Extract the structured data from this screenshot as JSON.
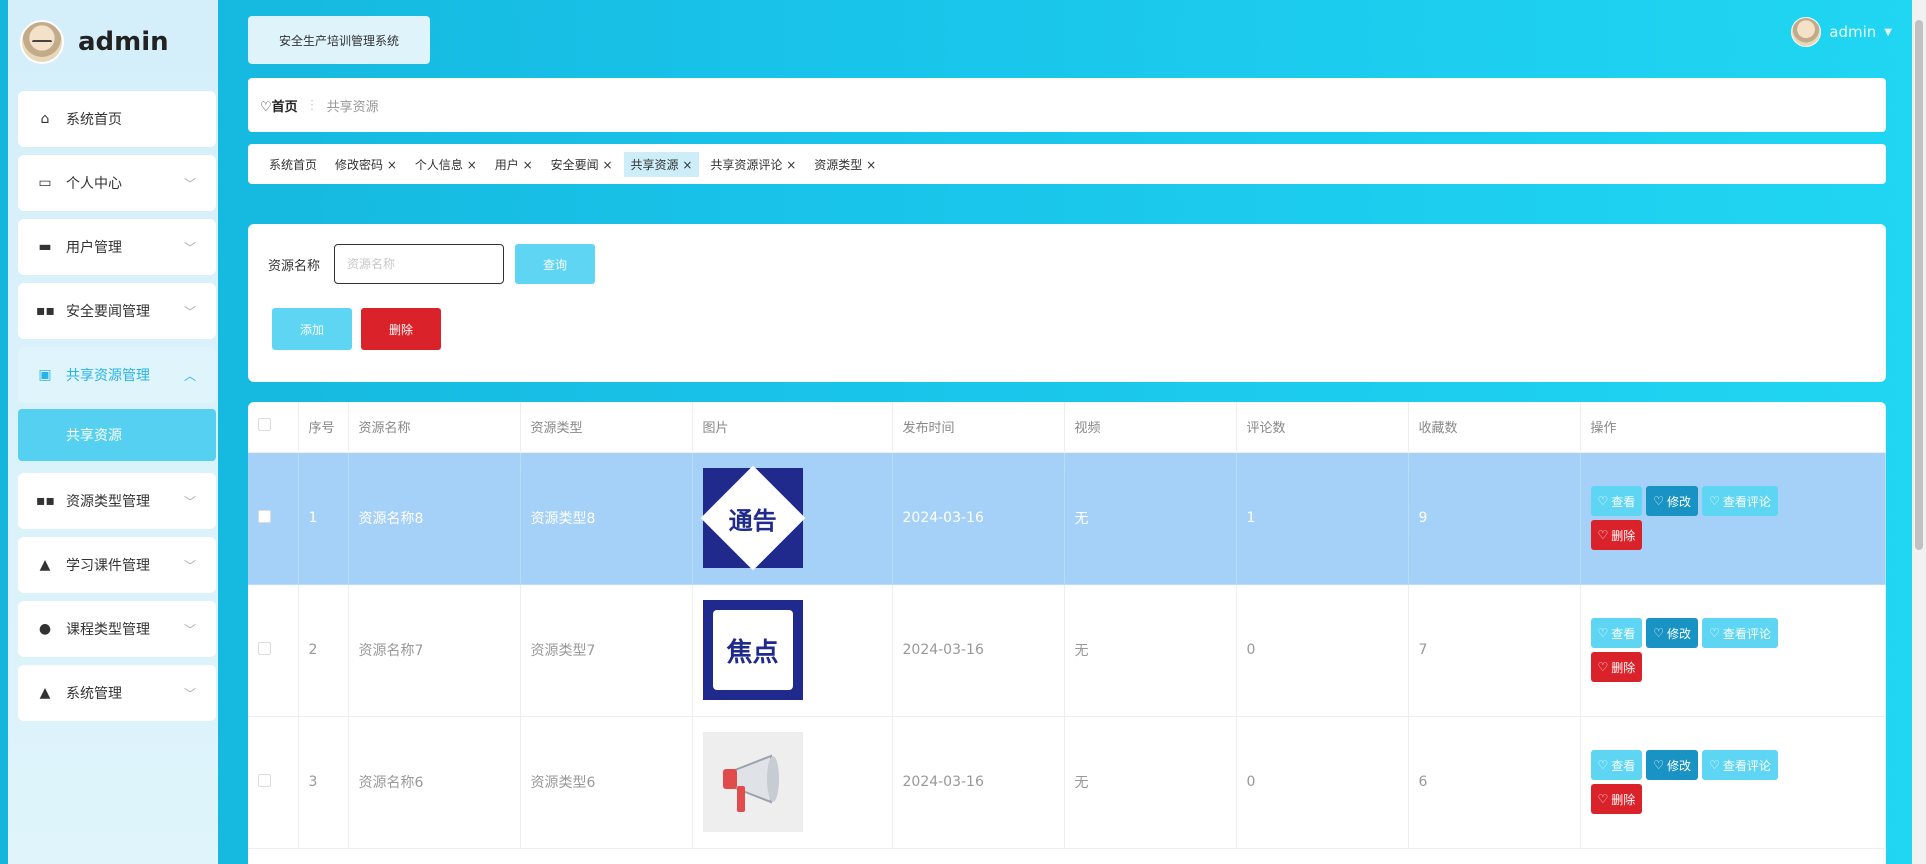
{
  "brand": {
    "name": "admin"
  },
  "sidebar": {
    "items": [
      {
        "label": "系统首页",
        "icon": "home-icon"
      },
      {
        "label": "个人中心",
        "icon": "card-icon"
      },
      {
        "label": "用户管理",
        "icon": "monitor-icon"
      },
      {
        "label": "安全要闻管理",
        "icon": "grid-icon"
      },
      {
        "label": "共享资源管理",
        "icon": "clipboard-icon"
      },
      {
        "label": "资源类型管理",
        "icon": "grid-icon"
      },
      {
        "label": "学习课件管理",
        "icon": "user-icon"
      },
      {
        "label": "课程类型管理",
        "icon": "pin-icon"
      },
      {
        "label": "系统管理",
        "icon": "user-icon"
      }
    ],
    "submenu": {
      "label": "共享资源"
    }
  },
  "header": {
    "system_title": "安全生产培训管理系统",
    "user": "admin"
  },
  "breadcrumb": {
    "home": "首页",
    "current": "共享资源"
  },
  "tags": [
    {
      "label": "系统首页"
    },
    {
      "label": "修改密码 ×"
    },
    {
      "label": "个人信息 ×"
    },
    {
      "label": "用户 ×"
    },
    {
      "label": "安全要闻 ×"
    },
    {
      "label": "共享资源 ×"
    },
    {
      "label": "共享资源评论 ×"
    },
    {
      "label": "资源类型 ×"
    }
  ],
  "search": {
    "label": "资源名称",
    "placeholder": "资源名称",
    "query_label": "查询",
    "add_label": "添加",
    "delete_label": "删除"
  },
  "table": {
    "headers": [
      "",
      "序号",
      "资源名称",
      "资源类型",
      "图片",
      "发布时间",
      "视频",
      "评论数",
      "收藏数",
      "操作"
    ],
    "rows": [
      {
        "index": "1",
        "name": "资源名称8",
        "type": "资源类型8",
        "image_text": "通告",
        "date": "2024-03-16",
        "video": "无",
        "comments": "1",
        "favorites": "9"
      },
      {
        "index": "2",
        "name": "资源名称7",
        "type": "资源类型7",
        "image_text": "焦点",
        "date": "2024-03-16",
        "video": "无",
        "comments": "0",
        "favorites": "7"
      },
      {
        "index": "3",
        "name": "资源名称6",
        "type": "资源类型6",
        "image_text": "",
        "date": "2024-03-16",
        "video": "无",
        "comments": "0",
        "favorites": "6"
      }
    ],
    "ops": {
      "view": "查看",
      "edit": "修改",
      "view_comments": "查看评论",
      "delete": "删除"
    }
  },
  "colors": {
    "accent": "#5ed6f3",
    "edit": "#1993c4",
    "danger": "#d9222a",
    "selected_row": "#a5d1f9"
  }
}
